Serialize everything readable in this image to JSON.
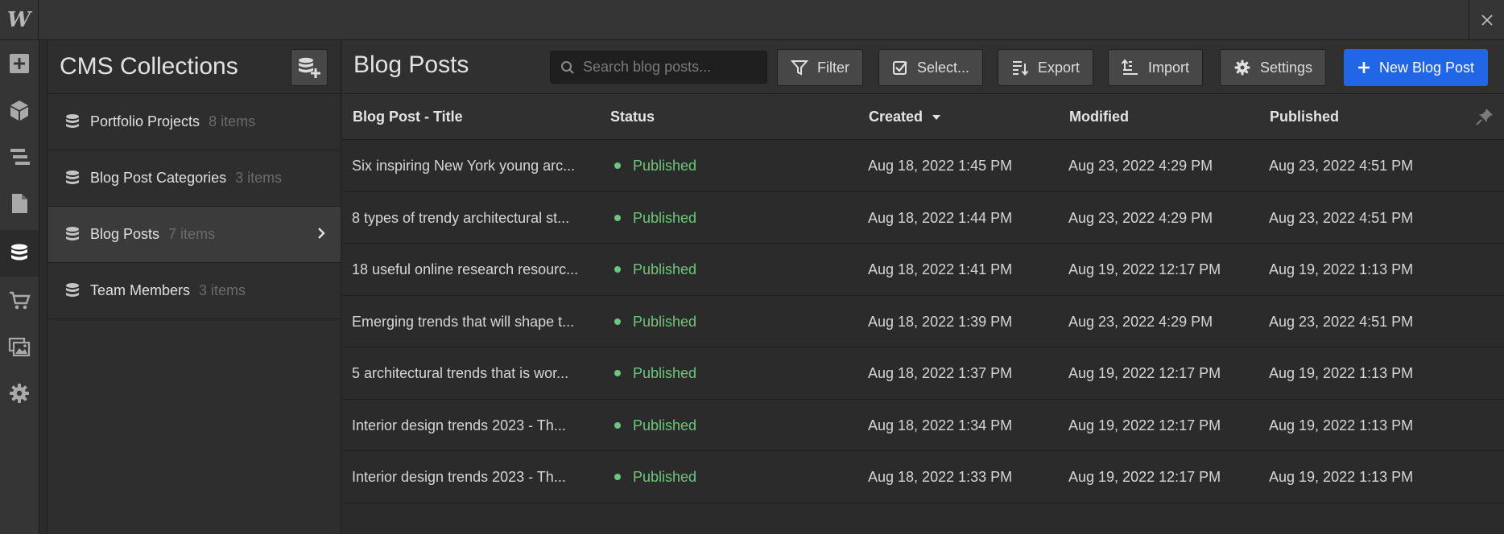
{
  "app": {
    "logo": "W"
  },
  "rail": {
    "items": [
      {
        "name": "add",
        "icon": "plus-square-icon"
      },
      {
        "name": "navigator",
        "icon": "box-icon"
      },
      {
        "name": "layers",
        "icon": "layers-icon"
      },
      {
        "name": "pages",
        "icon": "page-icon"
      },
      {
        "name": "cms",
        "icon": "database-icon",
        "active": true
      },
      {
        "name": "ecommerce",
        "icon": "cart-icon"
      },
      {
        "name": "assets",
        "icon": "images-icon"
      },
      {
        "name": "settings",
        "icon": "gear-icon"
      }
    ]
  },
  "collections": {
    "title": "CMS Collections",
    "items": [
      {
        "name": "Portfolio Projects",
        "count": "8 items"
      },
      {
        "name": "Blog Post Categories",
        "count": "3 items"
      },
      {
        "name": "Blog Posts",
        "count": "7 items",
        "active": true
      },
      {
        "name": "Team Members",
        "count": "3 items"
      }
    ]
  },
  "main": {
    "title": "Blog Posts",
    "search": {
      "placeholder": "Search blog posts..."
    },
    "buttons": {
      "filter": "Filter",
      "select": "Select...",
      "export": "Export",
      "import": "Import",
      "settings": "Settings",
      "new": "New Blog Post"
    }
  },
  "table": {
    "columns": [
      "Blog Post - Title",
      "Status",
      "Created",
      "Modified",
      "Published"
    ],
    "sorted_column": "Created",
    "rows": [
      {
        "title": "Six inspiring New York young arc...",
        "status": "Published",
        "created": "Aug 18, 2022 1:45 PM",
        "modified": "Aug 23, 2022 4:29 PM",
        "published": "Aug 23, 2022 4:51 PM"
      },
      {
        "title": "8 types of trendy architectural st...",
        "status": "Published",
        "created": "Aug 18, 2022 1:44 PM",
        "modified": "Aug 23, 2022 4:29 PM",
        "published": "Aug 23, 2022 4:51 PM"
      },
      {
        "title": "18 useful online research resourc...",
        "status": "Published",
        "created": "Aug 18, 2022 1:41 PM",
        "modified": "Aug 19, 2022 12:17 PM",
        "published": "Aug 19, 2022 1:13 PM"
      },
      {
        "title": "Emerging trends that will shape t...",
        "status": "Published",
        "created": "Aug 18, 2022 1:39 PM",
        "modified": "Aug 23, 2022 4:29 PM",
        "published": "Aug 23, 2022 4:51 PM"
      },
      {
        "title": "5 architectural trends that is wor...",
        "status": "Published",
        "created": "Aug 18, 2022 1:37 PM",
        "modified": "Aug 19, 2022 12:17 PM",
        "published": "Aug 19, 2022 1:13 PM"
      },
      {
        "title": "Interior design trends 2023 - Th...",
        "status": "Published",
        "created": "Aug 18, 2022 1:34 PM",
        "modified": "Aug 19, 2022 12:17 PM",
        "published": "Aug 19, 2022 1:13 PM"
      },
      {
        "title": "Interior design trends 2023 - Th...",
        "status": "Published",
        "created": "Aug 18, 2022 1:33 PM",
        "modified": "Aug 19, 2022 12:17 PM",
        "published": "Aug 19, 2022 1:13 PM"
      }
    ]
  },
  "colors": {
    "accent": "#2266e8",
    "status_published": "#6cc77a",
    "background": "#2b2b2b"
  }
}
